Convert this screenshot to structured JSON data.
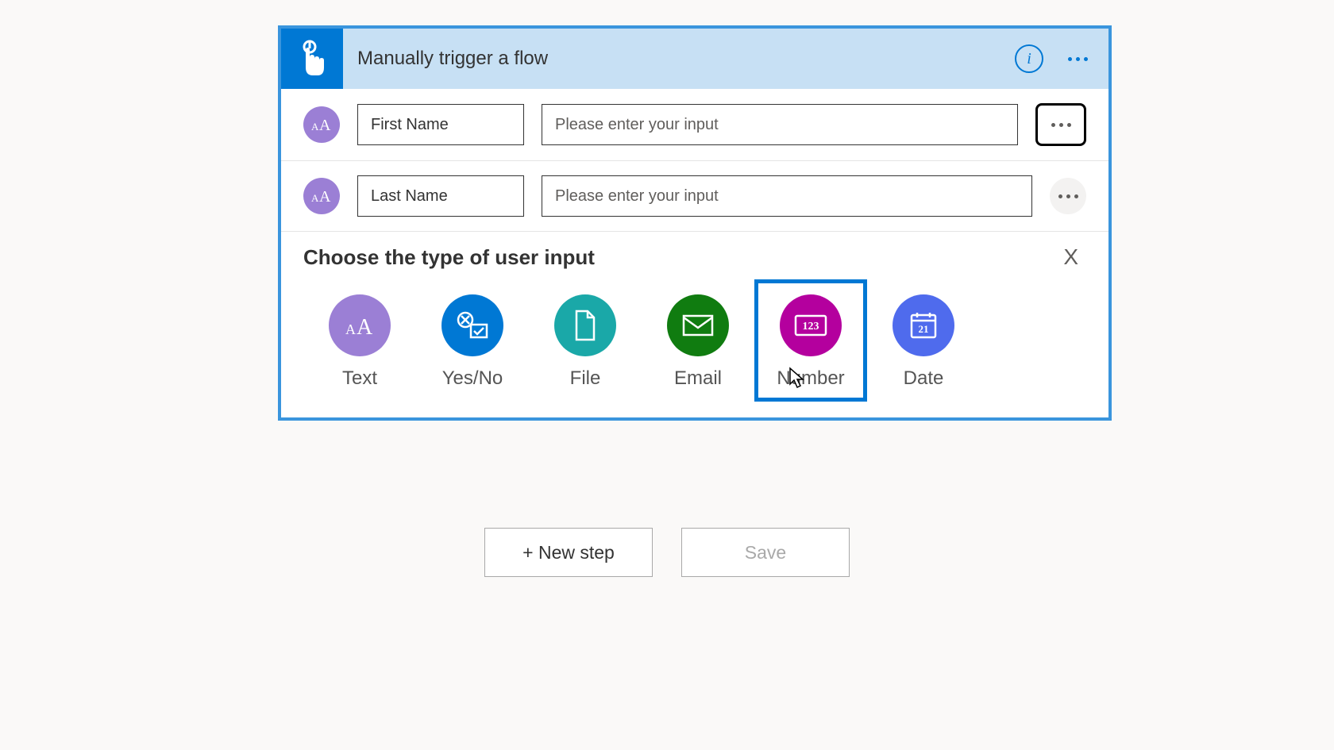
{
  "header": {
    "title": "Manually trigger a flow"
  },
  "inputs": [
    {
      "label": "First Name",
      "placeholder": "Please enter your input",
      "focused_more": true
    },
    {
      "label": "Last Name",
      "placeholder": "Please enter your input",
      "focused_more": false
    }
  ],
  "choose": {
    "title": "Choose the type of user input",
    "close": "X",
    "types": [
      {
        "key": "text",
        "label": "Text"
      },
      {
        "key": "yesno",
        "label": "Yes/No"
      },
      {
        "key": "file",
        "label": "File"
      },
      {
        "key": "email",
        "label": "Email"
      },
      {
        "key": "number",
        "label": "Number",
        "selected": true
      },
      {
        "key": "date",
        "label": "Date",
        "date_day": "21"
      }
    ]
  },
  "actions": {
    "new_step": "+ New step",
    "save": "Save"
  }
}
